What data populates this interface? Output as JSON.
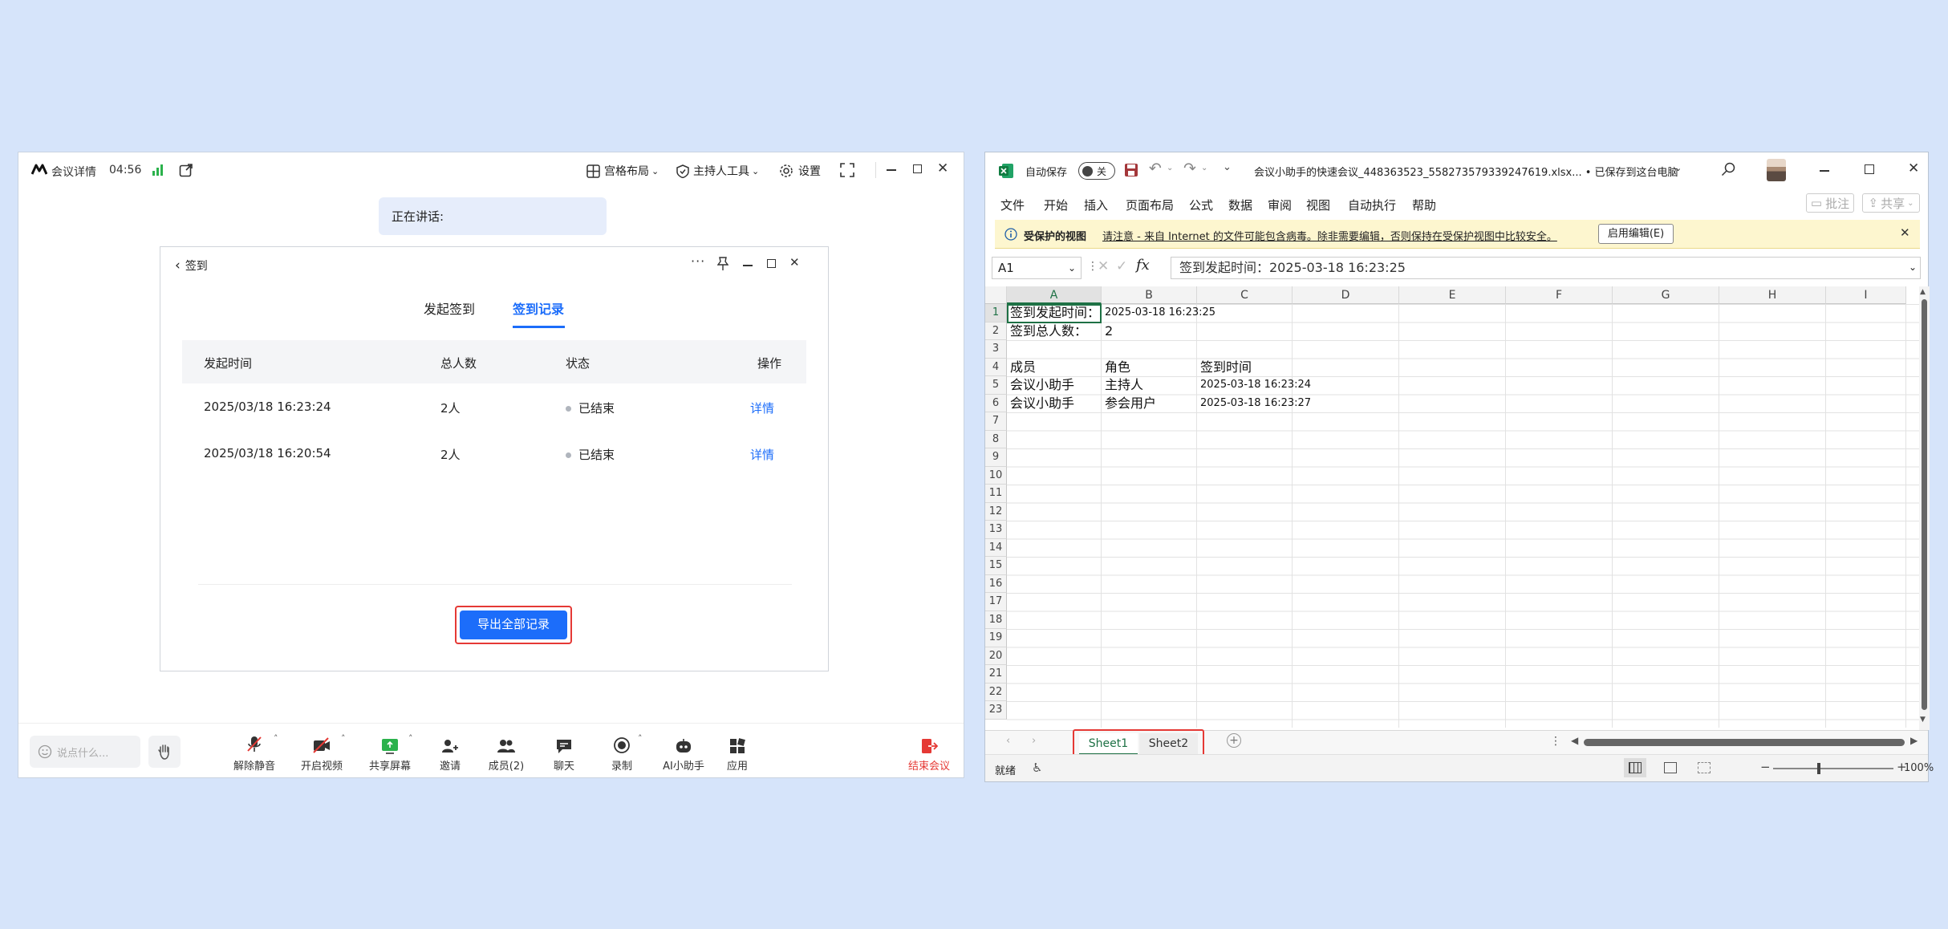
{
  "meeting": {
    "title": "会议详情",
    "timer": "04:56",
    "layout_label": "宫格布局",
    "host_tools_label": "主持人工具",
    "settings_label": "设置",
    "speaking_label": "正在讲话:",
    "dialog": {
      "back_label": "签到",
      "tabs": [
        "发起签到",
        "签到记录"
      ],
      "active_tab": 1,
      "columns": [
        "发起时间",
        "总人数",
        "状态",
        "操作"
      ],
      "rows": [
        {
          "time": "2025/03/18 16:23:24",
          "count": "2人",
          "status": "已结束",
          "action": "详情"
        },
        {
          "time": "2025/03/18 16:20:54",
          "count": "2人",
          "status": "已结束",
          "action": "详情"
        }
      ],
      "export_button": "导出全部记录"
    },
    "chat_placeholder": "说点什么...",
    "toolbar": {
      "unmute": "解除静音",
      "video": "开启视频",
      "share": "共享屏幕",
      "invite": "邀请",
      "members": "成员(2)",
      "chat": "聊天",
      "record": "录制",
      "ai": "AI小助手",
      "apps": "应用",
      "end": "结束会议"
    },
    "colors": {
      "accent": "#1c6dfa",
      "danger": "#e53935"
    }
  },
  "excel": {
    "autosave_label": "自动保存",
    "autosave_state": "关",
    "file_title": "会议小助手的快速会议_448363523_558273579339247619.xlsx... • 已保存到这台电脑",
    "menu": [
      "文件",
      "开始",
      "插入",
      "页面布局",
      "公式",
      "数据",
      "审阅",
      "视图",
      "自动执行",
      "帮助"
    ],
    "comment_btn": "批注",
    "share_btn": "共享",
    "protected_title": "受保护的视图",
    "protected_msg": "请注意 - 来自 Internet 的文件可能包含病毒。除非需要编辑，否则保持在受保护视图中比较安全。",
    "enable_edit": "启用编辑(E)",
    "name_box": "A1",
    "formula": "签到发起时间：2025-03-18 16:23:25",
    "columns": [
      "A",
      "B",
      "C",
      "D",
      "E",
      "F",
      "G",
      "H",
      "I"
    ],
    "row_numbers": [
      "1",
      "2",
      "3",
      "4",
      "5",
      "6",
      "7",
      "8",
      "9",
      "10",
      "11",
      "12",
      "13",
      "14",
      "15",
      "16",
      "17",
      "18",
      "19",
      "20",
      "21",
      "22",
      "23"
    ],
    "cells": {
      "A1": "签到发起时间：",
      "B1": "2025-03-18 16:23:25",
      "A2": "签到总人数：",
      "B2": "2",
      "A4": "成员",
      "B4": "角色",
      "C4": "签到时间",
      "A5": "会议小助手",
      "B5": "主持人",
      "C5": "2025-03-18 16:23:24",
      "A6": "会议小助手",
      "B6": "参会用户",
      "C6": "2025-03-18 16:23:27"
    },
    "sheets": [
      "Sheet1",
      "Sheet2"
    ],
    "status": "就绪",
    "zoom": "100%",
    "colors": {
      "excel_green": "#1e7145",
      "protected_bar": "#fdf6cf"
    }
  }
}
